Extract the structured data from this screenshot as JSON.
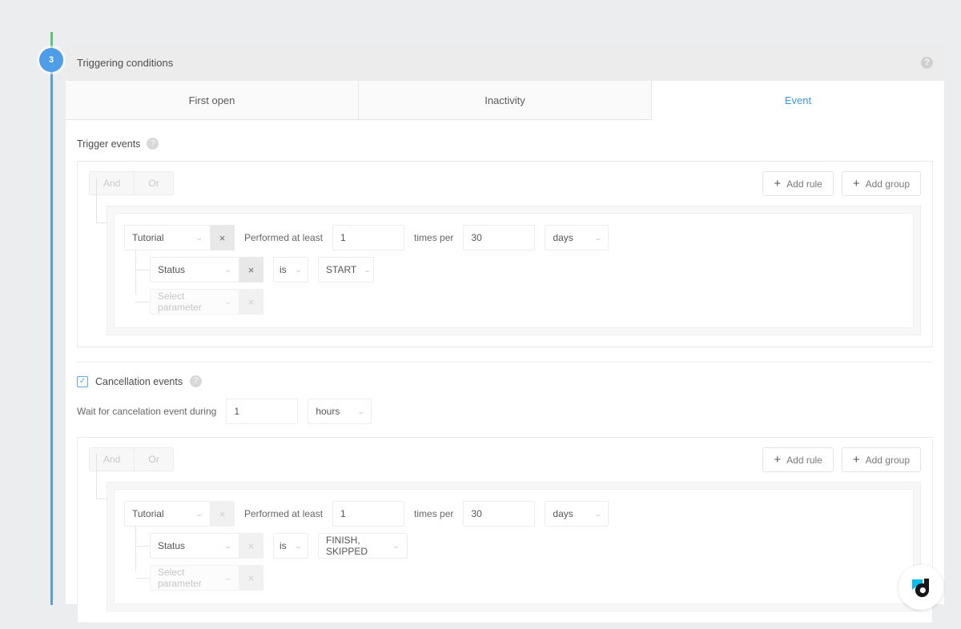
{
  "step": {
    "number": "3",
    "title": "Triggering conditions"
  },
  "help_glyph": "?",
  "tabs": [
    {
      "label": "First open",
      "active": false
    },
    {
      "label": "Inactivity",
      "active": false
    },
    {
      "label": "Event",
      "active": true
    }
  ],
  "trigger_section": {
    "label": "Trigger events",
    "andor": {
      "and": "And",
      "or": "Or"
    },
    "buttons": {
      "add_rule": "Add rule",
      "add_group": "Add group",
      "plus": "+"
    },
    "rule": {
      "event": "Tutorial",
      "performed_label": "Performed at least",
      "count": "1",
      "times_per_label": "times per",
      "period": "30",
      "unit": "days",
      "remove": "×"
    },
    "subrules": [
      {
        "parameter": "Status",
        "operator": "is",
        "value": "START",
        "remove": "×",
        "muted": false
      },
      {
        "parameter": "Select parameter",
        "remove": "×",
        "muted": true
      }
    ]
  },
  "cancellation_section": {
    "checkbox_label": "Cancellation events",
    "checked": true,
    "check_glyph": "✓",
    "wait_label": "Wait for cancelation event during",
    "wait_value": "1",
    "wait_unit": "hours",
    "andor": {
      "and": "And",
      "or": "Or"
    },
    "buttons": {
      "add_rule": "Add rule",
      "add_group": "Add group",
      "plus": "+"
    },
    "rule": {
      "event": "Tutorial",
      "performed_label": "Performed at least",
      "count": "1",
      "times_per_label": "times per",
      "period": "30",
      "unit": "days",
      "remove": "×"
    },
    "subrules": [
      {
        "parameter": "Status",
        "operator": "is",
        "value": "FINISH, SKIPPED",
        "remove": "×",
        "muted": false
      },
      {
        "parameter": "Select parameter",
        "remove": "×",
        "muted": true
      }
    ]
  },
  "colors": {
    "accent_blue": "#3d97e8",
    "step_blue": "#4f9de6",
    "rail_green": "#5cc47c",
    "logo_cyan": "#00bdf2",
    "logo_dark": "#14161a",
    "background": "#ebedef"
  },
  "caret": "⌄"
}
